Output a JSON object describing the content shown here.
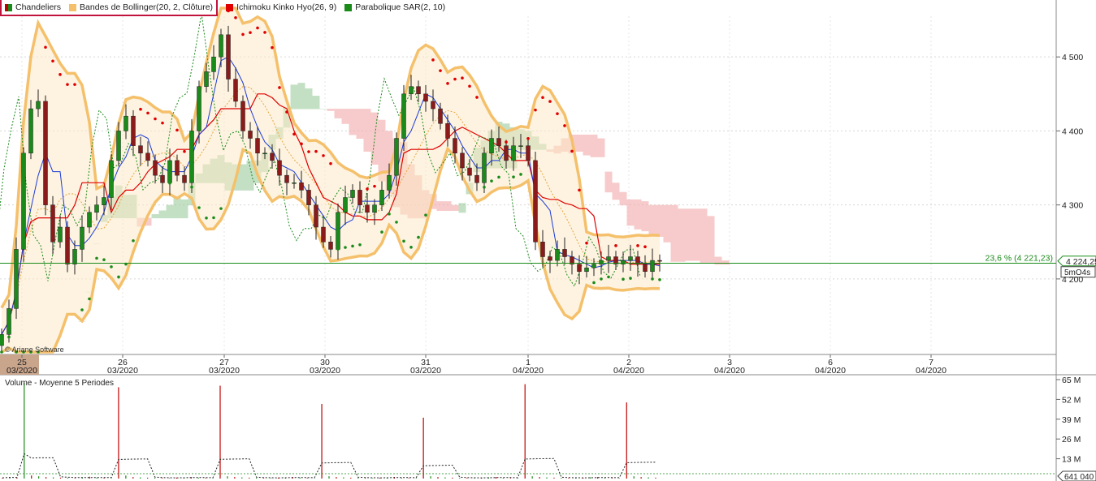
{
  "legend": {
    "candles": {
      "label": "Chandeliers",
      "color": "#1a8a1a"
    },
    "bollinger": {
      "label": "Bandes de Bollinger(20, 2, Clôture)",
      "color": "#f5c06b"
    },
    "ichimoku": {
      "label": "Ichimoku Kinko Hyo(26, 9)",
      "color": "#e00000"
    },
    "sar": {
      "label": "Parabolique SAR(2, 10)",
      "color": "#1a8a1a"
    }
  },
  "watermark": "© Ariane Software",
  "price_axis": {
    "ticks": [
      "4 500",
      "4 400",
      "4 300",
      "4 200"
    ]
  },
  "fib_label": "23,6 % (4 221,23)",
  "last_price": "4 224,25",
  "timeframe": "5mO4s",
  "date_axis": [
    {
      "day": "25",
      "month": "03/2020",
      "highlight": true
    },
    {
      "day": "26",
      "month": "03/2020"
    },
    {
      "day": "27",
      "month": "03/2020"
    },
    {
      "day": "30",
      "month": "03/2020"
    },
    {
      "day": "31",
      "month": "03/2020"
    },
    {
      "day": "1",
      "month": "04/2020"
    },
    {
      "day": "2",
      "month": "04/2020"
    },
    {
      "day": "3",
      "month": "04/2020"
    },
    {
      "day": "6",
      "month": "04/2020"
    },
    {
      "day": "7",
      "month": "04/2020"
    }
  ],
  "volume_panel": {
    "title": "Volume  - Moyenne 5 Periodes",
    "ticks": [
      "65 M",
      "52 M",
      "39 M",
      "26 M",
      "13 M"
    ],
    "last_value": "641 040"
  },
  "chart_data": {
    "type": "candlestick",
    "ylim": [
      4110,
      4555
    ],
    "fib_level": 4221.23,
    "last_close": 4224.25,
    "close": [
      4125,
      4160,
      4240,
      4370,
      4430,
      4440,
      4300,
      4250,
      4270,
      4220,
      4240,
      4270,
      4290,
      4300,
      4310,
      4360,
      4400,
      4420,
      4380,
      4370,
      4360,
      4340,
      4330,
      4360,
      4340,
      4330,
      4400,
      4460,
      4480,
      4500,
      4530,
      4470,
      4440,
      4400,
      4390,
      4370,
      4370,
      4360,
      4340,
      4330,
      4330,
      4320,
      4300,
      4270,
      4250,
      4240,
      4290,
      4310,
      4320,
      4300,
      4290,
      4300,
      4320,
      4340,
      4390,
      4450,
      4460,
      4450,
      4440,
      4430,
      4410,
      4390,
      4370,
      4350,
      4340,
      4330,
      4370,
      4390,
      4380,
      4360,
      4380,
      4380,
      4360,
      4250,
      4230,
      4225,
      4240,
      4230,
      4220,
      4210,
      4215,
      4220,
      4225,
      4230,
      4220,
      4225,
      4230,
      4220,
      4210,
      4225,
      4224
    ],
    "volume_M": [
      0.5,
      1,
      0.8,
      63,
      2,
      1.5,
      1,
      0.8,
      0.6,
      0.5,
      0.4,
      0.8,
      1.2,
      0.6,
      0.5,
      0.4,
      60,
      2,
      1,
      0.8,
      0.6,
      0.5,
      0.4,
      0.3,
      0.6,
      0.8,
      1,
      0.5,
      0.4,
      0.3,
      61,
      1.5,
      1,
      0.8,
      0.6,
      0.5,
      0.4,
      0.3,
      0.6,
      0.8,
      1,
      0.5,
      0.4,
      0.3,
      49,
      1.5,
      1,
      0.8,
      0.6,
      0.5,
      0.4,
      0.3,
      0.6,
      0.8,
      1,
      0.5,
      0.4,
      0.3,
      40,
      1.5,
      1,
      0.8,
      0.6,
      0.5,
      0.4,
      0.3,
      0.6,
      0.8,
      1,
      0.5,
      0.4,
      0.3,
      62,
      1.5,
      1,
      0.8,
      0.6,
      0.5,
      0.4,
      0.3,
      0.6,
      0.8,
      1,
      0.5,
      0.4,
      0.3,
      50,
      1.5,
      1,
      0.8,
      0.6
    ],
    "volume_ylim": [
      0,
      65
    ]
  }
}
